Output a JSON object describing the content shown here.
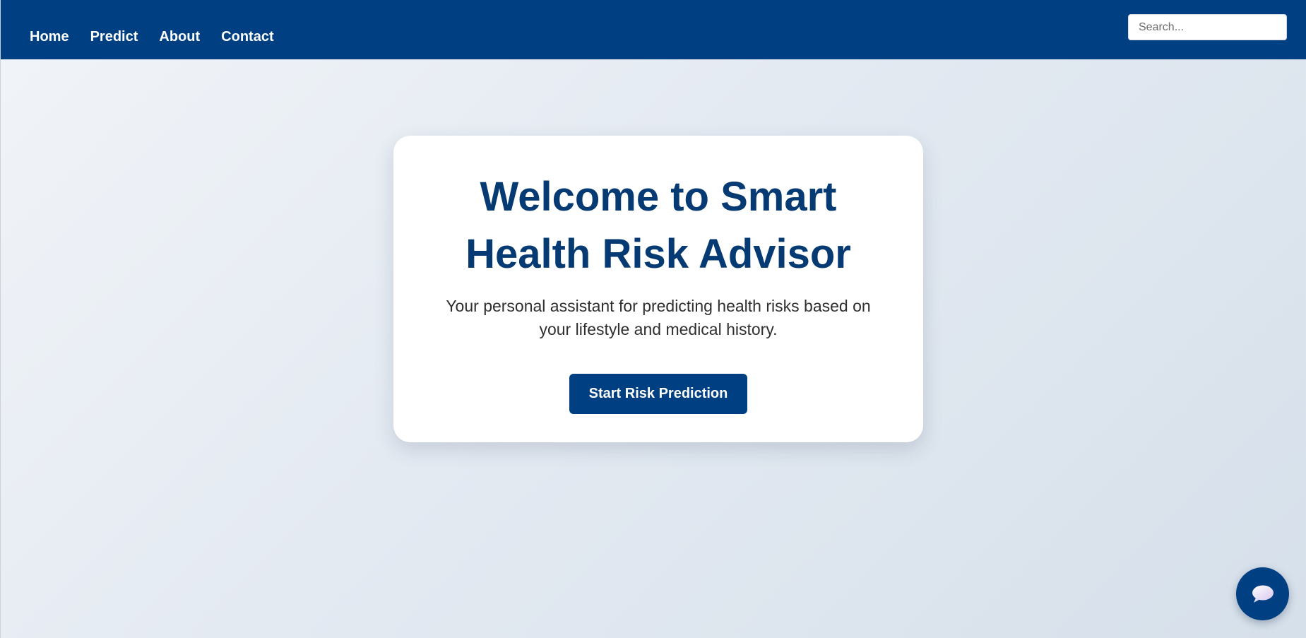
{
  "nav": {
    "items": [
      {
        "label": "Home"
      },
      {
        "label": "Predict"
      },
      {
        "label": "About"
      },
      {
        "label": "Contact"
      }
    ],
    "search_placeholder": "Search..."
  },
  "hero": {
    "title": "Welcome to Smart Health Risk Advisor",
    "subtitle": "Your personal assistant for predicting health risks based on your lifestyle and medical history.",
    "button_label": "Start Risk Prediction"
  },
  "chat": {
    "icon": "chat-bubble-icon"
  },
  "colors": {
    "primary": "#003f82",
    "title": "#063a73",
    "card_background": "#ffffff"
  }
}
